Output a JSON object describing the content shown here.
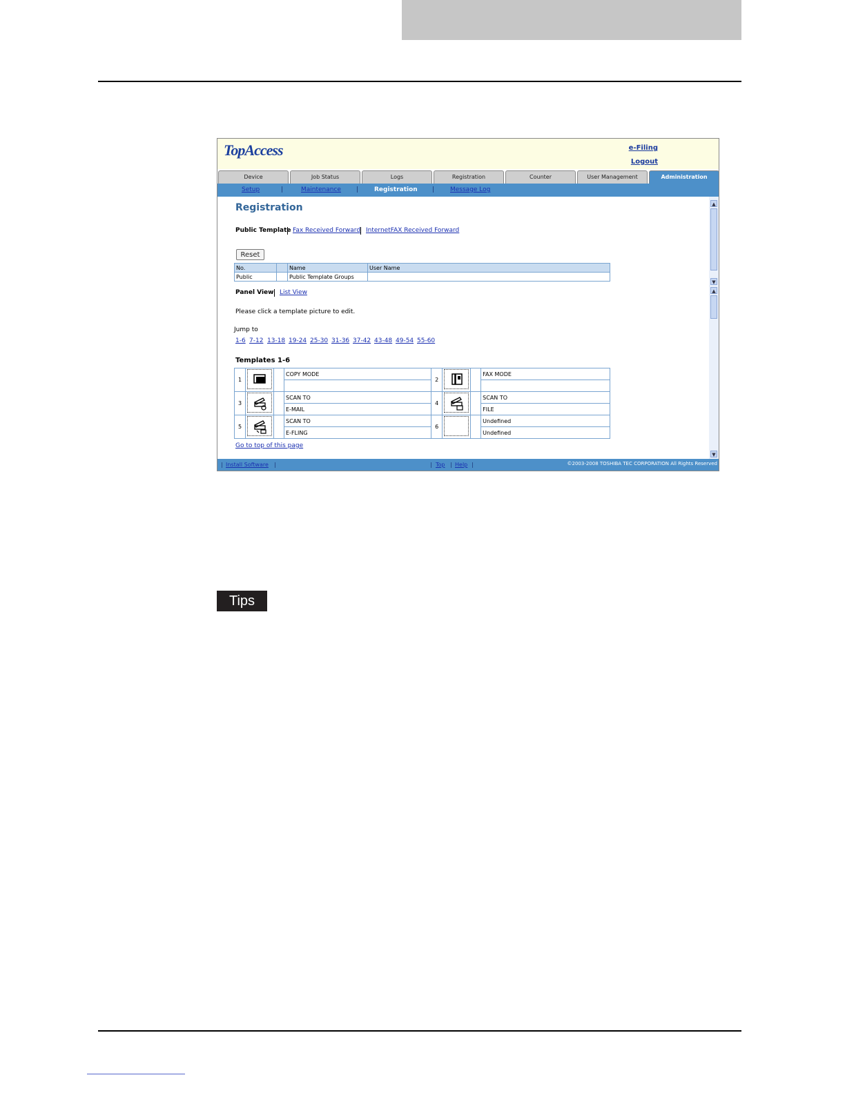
{
  "app": {
    "logo": "TopAccess",
    "top_links": [
      "e-Filing",
      "Logout"
    ]
  },
  "tabs": [
    "Device",
    "Job Status",
    "Logs",
    "Registration",
    "Counter",
    "User Management",
    "Administration"
  ],
  "subnav": {
    "items": [
      "Setup",
      "Maintenance",
      "Registration",
      "Message Log"
    ],
    "current": "Registration"
  },
  "page": {
    "title": "Registration",
    "template_nav": [
      "Public Template",
      "Fax Received Forward",
      "InternetFAX Received Forward"
    ],
    "reset_label": "Reset",
    "group_table": {
      "headers": [
        "No.",
        "",
        "Name",
        "User Name"
      ],
      "row": [
        "Public",
        "",
        "Public Template Groups",
        ""
      ]
    },
    "view_nav": [
      "Panel View",
      "List View"
    ],
    "instruction": "Please click a template picture to edit.",
    "jump_label": "Jump to",
    "jump_links": [
      "1-6",
      "7-12",
      "13-18",
      "19-24",
      "25-30",
      "31-36",
      "37-42",
      "43-48",
      "49-54",
      "55-60"
    ],
    "templates_heading": "Templates 1-6",
    "templates": [
      {
        "no": "1",
        "icon": "copy-mode-icon",
        "line1": "COPY MODE",
        "line2": ""
      },
      {
        "no": "2",
        "icon": "fax-mode-icon",
        "line1": "FAX MODE",
        "line2": ""
      },
      {
        "no": "3",
        "icon": "scan-to-email-icon",
        "line1": "SCAN TO",
        "line2": "E-MAIL"
      },
      {
        "no": "4",
        "icon": "scan-to-file-icon",
        "line1": "SCAN TO",
        "line2": "FILE"
      },
      {
        "no": "5",
        "icon": "scan-to-efiling-icon",
        "line1": "SCAN TO",
        "line2": "E-FLING"
      },
      {
        "no": "6",
        "icon": "undefined-icon",
        "line1": "Undefined",
        "line2": "Undefined"
      }
    ],
    "go_top": "Go to top of this page"
  },
  "footer": {
    "links": [
      "Install Software",
      "Top",
      "Help"
    ],
    "copyright": "©2003-2008 TOSHIBA TEC CORPORATION All Rights Reserved"
  },
  "tips_label": "Tips",
  "colors": {
    "accent": "#4d90c9",
    "header_bg": "#fdfde3",
    "link": "#1a2fb0",
    "tips_bg": "#231f20",
    "gray_block": "#c6c6c6"
  }
}
